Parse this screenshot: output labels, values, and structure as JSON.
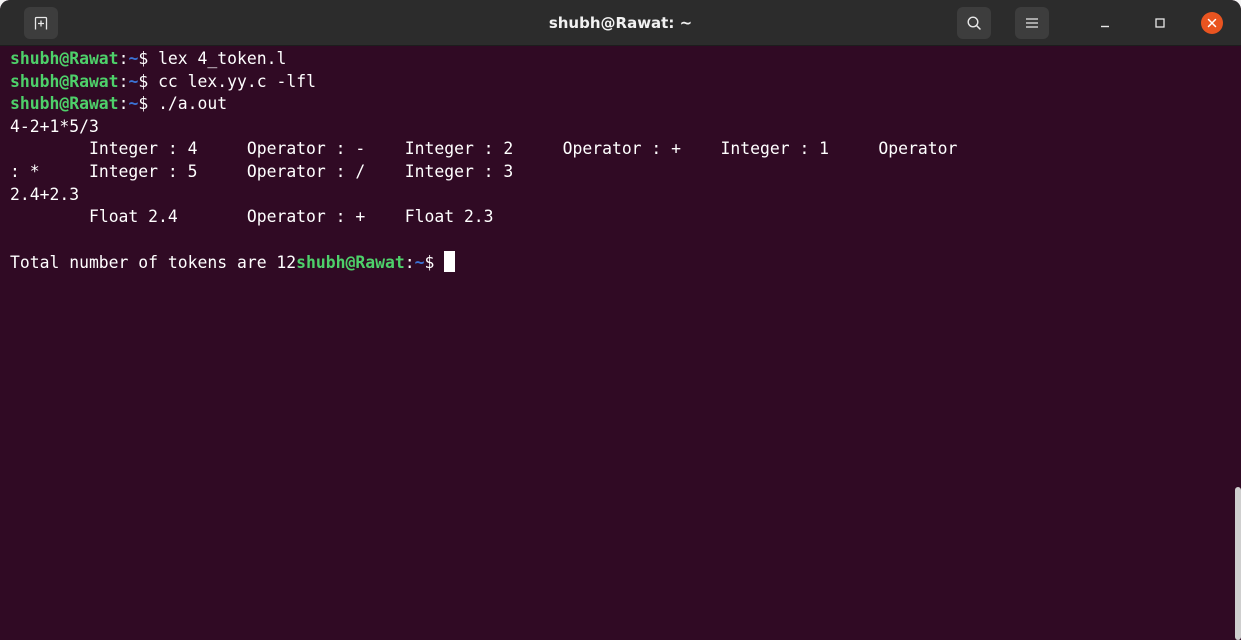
{
  "window": {
    "title": "shubh@Rawat: ~",
    "buttons": {
      "new_tab": "new-tab-icon",
      "search": "search-icon",
      "menu": "hamburger-menu-icon",
      "minimize": "minimize-icon",
      "maximize": "maximize-icon",
      "close": "close-icon"
    },
    "colors": {
      "background": "#300a24",
      "prompt_user": "#4ed06a",
      "prompt_path": "#3b74d6",
      "close_button": "#e95420"
    }
  },
  "terminal": {
    "lines": [
      {
        "user": "shubh@Rawat",
        "path": "~",
        "symbol": "$ ",
        "cmd": "lex 4_token.l"
      },
      {
        "user": "shubh@Rawat",
        "path": "~",
        "symbol": "$ ",
        "cmd": "cc lex.yy.c -lfl"
      },
      {
        "user": "shubh@Rawat",
        "path": "~",
        "symbol": "$ ",
        "cmd": "./a.out"
      },
      {
        "text": "4-2+1*5/3"
      },
      {
        "text": "\tInteger : 4\tOperator : -\tInteger : 2\tOperator : +\tInteger : 1\tOperator"
      },
      {
        "text": ": *\tInteger : 5\tOperator : /\tInteger : 3"
      },
      {
        "text": "2.4+2.3"
      },
      {
        "text": "\tFloat 2.4\tOperator : +\tFloat 2.3"
      },
      {
        "text": ""
      },
      {
        "text": "Total number of tokens are 12",
        "user": "shubh@Rawat",
        "path": "~",
        "symbol": "$ "
      }
    ]
  }
}
